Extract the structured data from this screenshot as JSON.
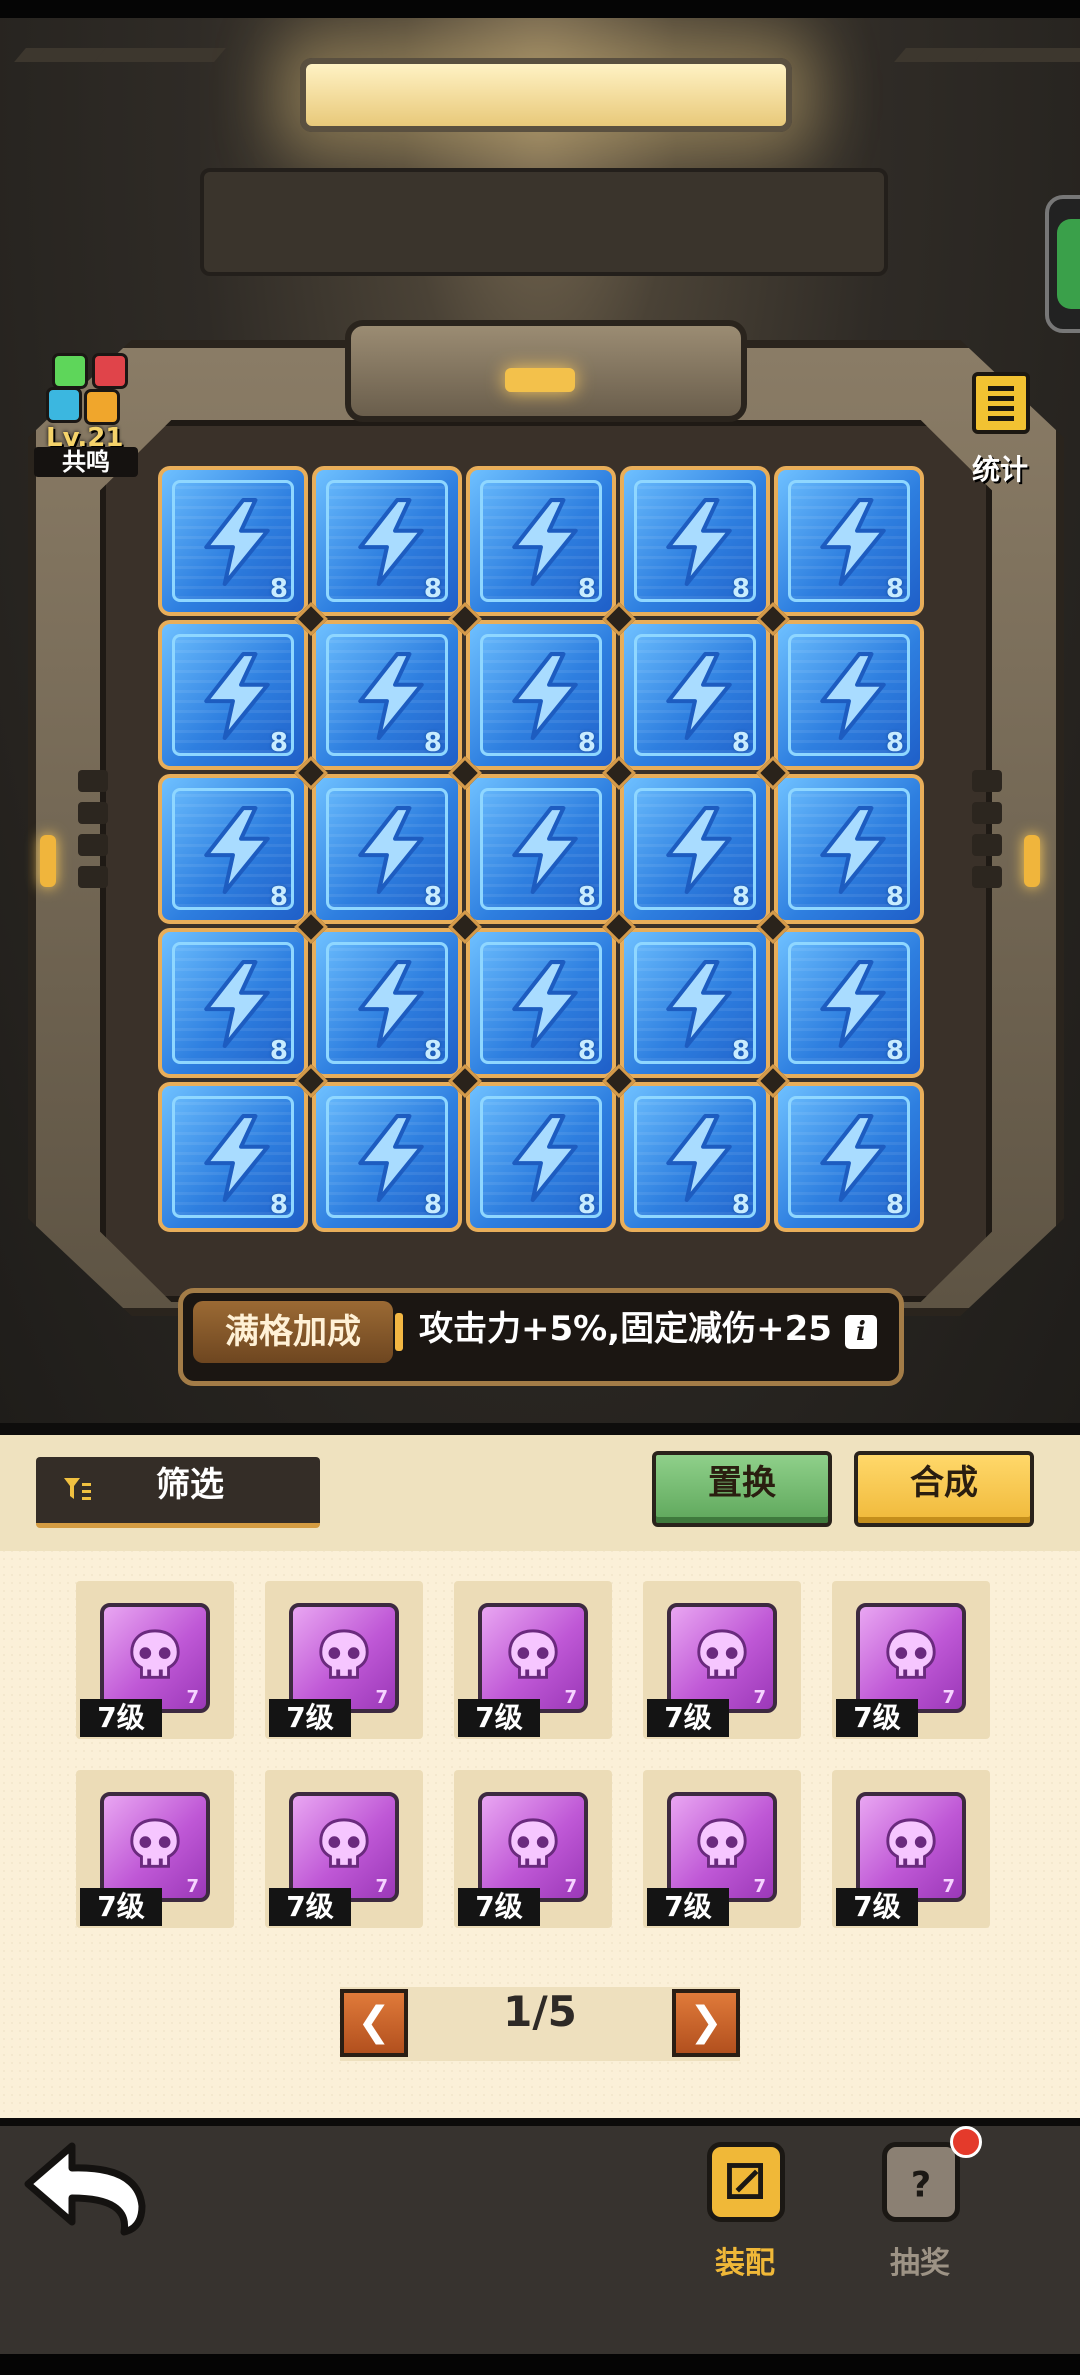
{
  "resonance": {
    "level": "Lv.21",
    "label": "共鸣"
  },
  "stats": {
    "label": "统计"
  },
  "board": {
    "rows": 5,
    "cols": 5,
    "cell_level": "8",
    "cell_color": "#2e7fe0"
  },
  "bonus": {
    "tag": "满格加成",
    "text": "攻击力+5%,固定减伤+25",
    "info_icon": "info-icon"
  },
  "panel": {
    "filter_label": "筛选",
    "replace_label": "置换",
    "compose_label": "合成",
    "inventory": [
      {
        "level_label": "7级",
        "chip_level": "7"
      },
      {
        "level_label": "7级",
        "chip_level": "7"
      },
      {
        "level_label": "7级",
        "chip_level": "7"
      },
      {
        "level_label": "7级",
        "chip_level": "7"
      },
      {
        "level_label": "7级",
        "chip_level": "7"
      },
      {
        "level_label": "7级",
        "chip_level": "7"
      },
      {
        "level_label": "7级",
        "chip_level": "7"
      },
      {
        "level_label": "7级",
        "chip_level": "7"
      },
      {
        "level_label": "7级",
        "chip_level": "7"
      },
      {
        "level_label": "7级",
        "chip_level": "7"
      }
    ],
    "pager": {
      "prev": "❮",
      "next": "❯",
      "text": "1/5"
    }
  },
  "bottom_nav": {
    "equip_label": "装配",
    "lottery_label": "抽奖"
  },
  "colors": {
    "accent_gold": "#f2c232",
    "inventory_chip": "#bf58d6",
    "replace_button": "#5ea75b"
  }
}
